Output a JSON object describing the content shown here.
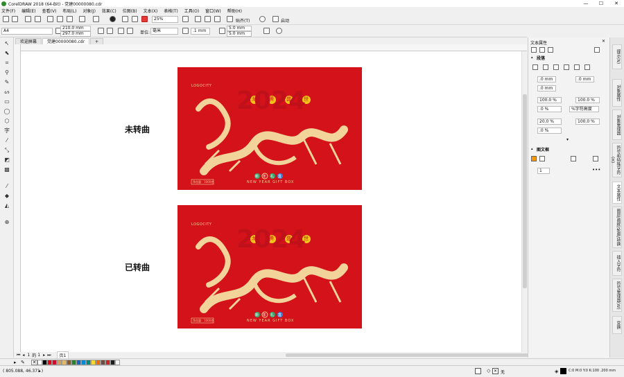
{
  "window": {
    "title": "CorelDRAW 2018 (64-Bit) - 党建00000080.cdr",
    "controls": [
      "—",
      "☐",
      "✕"
    ]
  },
  "menu": [
    "文件(F)",
    "编辑(E)",
    "查看(V)",
    "布局(L)",
    "对象(J)",
    "效果(C)",
    "位图(B)",
    "文本(X)",
    "表格(T)",
    "工具(O)",
    "窗口(W)",
    "帮助(H)"
  ],
  "toolbar": {
    "zoom": "25%",
    "snap": "贴齐(T)",
    "launch": "启动"
  },
  "propbar": {
    "page_size": "A4",
    "width": "210.0 mm",
    "height": "297.0 mm",
    "units_label": "单位:",
    "units": "毫米",
    "nudge": ".1 mm",
    "dup_x": "5.0 mm",
    "dup_y": "5.0 mm"
  },
  "tabs": {
    "welcome": "欢迎屏幕",
    "doc": "党建00000080.cdr",
    "add": "+"
  },
  "canvas": {
    "label_top": "未转曲",
    "label_bottom": "已转曲"
  },
  "card": {
    "logo": "LOGOCITY",
    "year": "2024",
    "seals": [
      "龙",
      "腾",
      "盛",
      "世"
    ],
    "sub_seals": [
      "新",
      "年",
      "礼",
      "盒"
    ],
    "english": "NEW YEAR GIFT BOX",
    "net": "净含量：1000克"
  },
  "pagenav": {
    "current": "1",
    "of": "的",
    "total": "1",
    "page_tab": "页1"
  },
  "status": {
    "coords": "( 805.088, 46.371 )",
    "arrow": "▸",
    "fill_none": "无",
    "color_info": "C:0 M:0 Y:0 K:100  .200 mm"
  },
  "docker": {
    "title": "文本属性",
    "paragraph": "段落",
    "frame": "图文框",
    "fields": {
      "indent_l": ".0 mm",
      "indent_r": ".0 mm",
      "first": ".0 mm",
      "spacing_before": "100.0 %",
      "spacing_after": "100.0 %",
      "line_pct": ".0 %",
      "line_unit": "%字符高度",
      "char_space": "20.0 %",
      "word_space": "100.0 %",
      "lang": ".0 %",
      "columns": "1"
    }
  },
  "docker_tabs": [
    "提示(N)",
    "对象属性",
    "对象管理器",
    "符号和特殊字符(H)",
    "文本属性",
    "图层/图框/轮廓/转换",
    "插入字符",
    "符号管理器(W)",
    "变换"
  ],
  "palette_colors": [
    "#ffffff",
    "#000000",
    "#e30613",
    "#c8102e",
    "#d4a05a",
    "#e3b970",
    "#8b5a2b",
    "#2e7d32",
    "#1565c0",
    "#0288d1",
    "#00897b",
    "#fdd835",
    "#ef6c00",
    "#6d4c41",
    "#c62828",
    "#1b1b1b",
    "#f5f5f5"
  ],
  "colors": {
    "card_red": "#d4121a",
    "gold": "#f2d39a",
    "accent_green": "#3aa36b",
    "accent_blue": "#3c7fd1"
  }
}
